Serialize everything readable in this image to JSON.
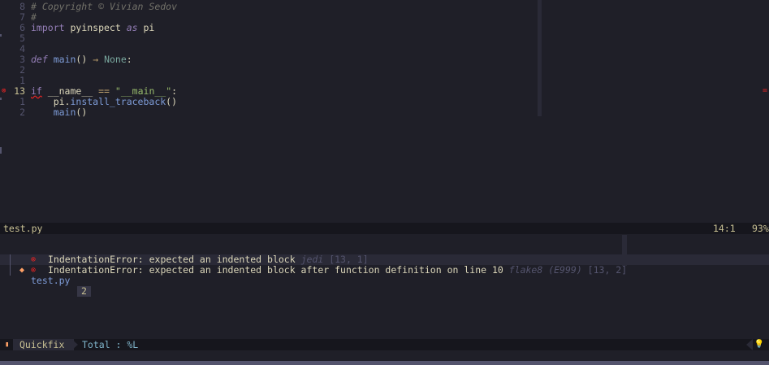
{
  "editor": {
    "lines": [
      {
        "num": "8",
        "tokens": [
          [
            "comment",
            "# Copyright © Vivian Sedov"
          ]
        ]
      },
      {
        "num": "7",
        "tokens": [
          [
            "comment",
            "#"
          ]
        ]
      },
      {
        "num": "6",
        "tokens": [
          [
            "kw",
            "import"
          ],
          [
            "ident",
            " pyinspect "
          ],
          [
            "kwi",
            "as"
          ],
          [
            "ident",
            " pi"
          ]
        ]
      },
      {
        "num": "5",
        "tokens": []
      },
      {
        "num": "4",
        "tokens": []
      },
      {
        "num": "3",
        "tokens": [
          [
            "kwi",
            "def"
          ],
          [
            "ident",
            " "
          ],
          [
            "fn",
            "main"
          ],
          [
            "ident",
            "() "
          ],
          [
            "op",
            "→"
          ],
          [
            "ident",
            " "
          ],
          [
            "typ",
            "None"
          ],
          [
            "ident",
            ":"
          ]
        ]
      },
      {
        "num": "2",
        "tokens": []
      },
      {
        "num": "1",
        "tokens": []
      },
      {
        "num": "13",
        "current": true,
        "sign": "⊗",
        "tokens": [
          [
            "kw",
            "if"
          ],
          [
            "ident",
            " __name__ "
          ],
          [
            "op",
            "=="
          ],
          [
            "ident",
            " "
          ],
          [
            "str",
            "\"__main__\""
          ],
          [
            "ident",
            ":"
          ]
        ]
      },
      {
        "num": "1",
        "tokens": [
          [
            "ident",
            "    pi."
          ],
          [
            "fn",
            "install_traceback"
          ],
          [
            "ident",
            "()"
          ]
        ]
      },
      {
        "num": "2",
        "tokens": [
          [
            "ident",
            "    "
          ],
          [
            "fn",
            "main"
          ],
          [
            "ident",
            "()"
          ]
        ]
      }
    ],
    "right_marker": "="
  },
  "status_top": {
    "filename": "test.py",
    "position": "14:1",
    "percent": "93%"
  },
  "quickfix": {
    "chevron": "⌄",
    "file_icon": "◆",
    "filename": "test.py",
    "count": "2",
    "items": [
      {
        "icon": "⊗",
        "message": "IndentationError: expected an indented block",
        "source": " jedi",
        "loc": " [13, 1]",
        "selected": true
      },
      {
        "icon": "⊗",
        "message": "IndentationError: expected an indented block after function definition on line 10",
        "source": " flake8 (E999)",
        "loc": " [13, 2]",
        "selected": false
      }
    ]
  },
  "status_bottom": {
    "light_icon": "▮",
    "label": "Quickfix",
    "total": "Total : %L",
    "bulb_icon": "💡"
  }
}
